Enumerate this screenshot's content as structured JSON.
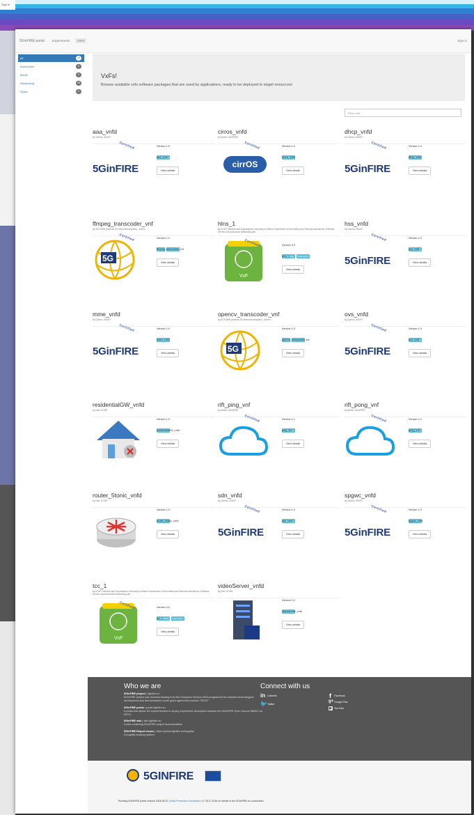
{
  "topbar": {
    "brand": "5GinFIRE portal",
    "nav": [
      "Experiments",
      "VxFs"
    ],
    "active": "VxFs",
    "signin": "Sign in",
    "outer_signin": "Sign in"
  },
  "sidebar": {
    "items": [
      {
        "label": "All",
        "count": "18",
        "active": true
      },
      {
        "label": "Automotive",
        "count": "0"
      },
      {
        "label": "Media",
        "count": "3"
      },
      {
        "label": "Networking",
        "count": "15"
      },
      {
        "label": "Space",
        "count": "0"
      }
    ]
  },
  "jumbotron": {
    "title": "VxFs!",
    "text": "Browse available vxfs software packages that are used by applications, ready to be deployed to target resources!"
  },
  "search": {
    "placeholder": "Filter vxfs..."
  },
  "certified_label": "Certified",
  "view_label": "View details",
  "vxfs": [
    {
      "name": "aaa_vnfd",
      "by": "by Cdemo, 5GinFI",
      "version": "Version 1.0",
      "tags": [
        "Networking"
      ],
      "short": "aaa_vnfd",
      "logo": "5ginfire",
      "certified": true
    },
    {
      "name": "cirros_vnfd",
      "by": "by Admin, 5GinFIRE",
      "version": "Version 1.0",
      "tags": [
        "Networking"
      ],
      "short": "cirros_vnfd",
      "logo": "cirros",
      "certified": true
    },
    {
      "name": "dhcp_vnfd",
      "by": "by Cdemo, 5GinFI",
      "version": "Version 1.0",
      "tags": [
        "Networking"
      ],
      "short": "dhcp_vnfd",
      "logo": "5ginfire",
      "certified": true
    },
    {
      "name": "ffmpeg_transcoder_vnf",
      "by": "by 5GTOWN (Instituto de Telecomunicações) - Aveiro",
      "version": "Version 1.1",
      "tags": [
        "Media",
        "Automotive"
      ],
      "short": "ffmpeg_transcoder_vnf",
      "logo": "5gtn",
      "certified": true
    },
    {
      "name": "hlns_1",
      "by": "by ECMT National and Kapodistrian University of Athens Department of Informatics and Telecommunications, Software Centric and Autonomic Networking lab",
      "version": "Version 4.0",
      "tags": [
        "Networking",
        "Automotive"
      ],
      "short": "hlns_1",
      "logo": "vxf",
      "certified": true
    },
    {
      "name": "hss_vnfd",
      "by": "by Cdemo, 5GinFI",
      "version": "Version 1.0",
      "tags": [
        "Networking"
      ],
      "short": "hss_vnfd",
      "logo": "5ginfire",
      "certified": true
    },
    {
      "name": "mme_vnfd",
      "by": "by Cdemo, 5GinFI",
      "version": "Version 1.0",
      "tags": [
        "Networking"
      ],
      "short": "mme_vnfd",
      "logo": "5ginfire",
      "certified": true
    },
    {
      "name": "opencv_transcoder_vnf",
      "by": "by 5GTOWN (Instituto de Telecomunicações) - Aveiro",
      "version": "Version 1.0",
      "tags": [
        "Media",
        "Automotive"
      ],
      "short": "opencv_transcoder_vnf",
      "logo": "5gtn",
      "certified": false
    },
    {
      "name": "ovs_vnfd",
      "by": "by Cdemo, 5GinFI",
      "version": "Version 1.0",
      "tags": [
        "Networking"
      ],
      "short": "ovs_vnfd",
      "logo": "5ginfire",
      "certified": true
    },
    {
      "name": "residentialGW_vnfd",
      "by": "by Intel, UC3M",
      "version": "Version 1.0",
      "tags": [
        "Networking"
      ],
      "short": "residentialGW_vnfd",
      "logo": "house",
      "certified": false
    },
    {
      "name": "rift_ping_vnf",
      "by": "by Admin, 5GinFIRE",
      "version": "Version 1.1",
      "tags": [
        "Networking"
      ],
      "short": "ping_vnf",
      "logo": "cloud",
      "certified": true
    },
    {
      "name": "rift_pong_vnf",
      "by": "by Admin, 5GinFIRE",
      "version": "Version 1.1",
      "tags": [
        "Networking"
      ],
      "short": "pong_vnf",
      "logo": "cloud",
      "certified": true
    },
    {
      "name": "router_5tonic_vnfd",
      "by": "by Intel, UC3M",
      "version": "Version 1.0",
      "tags": [
        "Networking"
      ],
      "short": "router_5tonic_vnfd",
      "logo": "router",
      "certified": false
    },
    {
      "name": "sdn_vnfd",
      "by": "by Cdemo, 5GinFI",
      "version": "Version 1.0",
      "tags": [
        "Networking"
      ],
      "short": "sdn_vnfd",
      "logo": "5ginfire",
      "certified": true
    },
    {
      "name": "spgwc_vnfd",
      "by": "by Cdemo, 5GinFI",
      "version": "Version 1.0",
      "tags": [
        "Networking"
      ],
      "short": "spgwc_vnfd",
      "logo": "5ginfire",
      "certified": true
    },
    {
      "name": "tcc_1",
      "by": "by ECMT National and Kapodistrian University of Athens Department of Informatics and Telecommunications, Software Centric and Autonomic Networking lab",
      "version": "Version 4.0",
      "tags": [
        "Networking",
        "Automotive"
      ],
      "short": "tcc_1",
      "logo": "vxf",
      "certified": true
    },
    {
      "name": "videoServer_vnfd",
      "by": "by Intel, UC3M",
      "version": "Version 1.0",
      "tags": [
        "Networking"
      ],
      "short": "videoserver_vnfd",
      "logo": "server",
      "certified": false
    }
  ],
  "footer": {
    "who_title": "Who we are",
    "who_items": [
      {
        "head": "5GinFIRE project",
        "link": "5ginfire.eu",
        "text": "5GinFIRE project has received funding from the European Horizon 2020 programme for research technological development and demonstration under grant agreement number 732497"
      },
      {
        "head": "5GinFIRE portal",
        "link": "portal.5ginfire.eu",
        "text": "A portal that allows 5G experimenters to deploy experiment description towards the 5GinFIRE Open Source MANO via NFVO"
      },
      {
        "head": "5GinFIRE wiki",
        "link": "wiki.5ginfire.eu",
        "text": "A wiki containing 5GinFIRE project documentation"
      },
      {
        "head": "5GinFIRE Report issues",
        "link": "https://portal.5ginfire.eu/bugzilla/",
        "text": "A bugzilla tracking system"
      }
    ],
    "connect_title": "Connect with us",
    "social": [
      "LinkedIn",
      "Twitter",
      "Facebook",
      "Google Plus",
      "YouTube"
    ],
    "copyright_pre": "Running 5GinFIRE portal version 2018.05.07 |",
    "copyright_link": "Data Protection Declaration",
    "copyright_post": "| © 2017-2018 on behalf of the 5GinFIRE.eu consortium",
    "logo_text": "5GINFIRE"
  },
  "colors": {
    "accent": "#337ab7",
    "brand": "#1f3a7a",
    "tag": "#5bc0de",
    "footer": "#555555"
  }
}
